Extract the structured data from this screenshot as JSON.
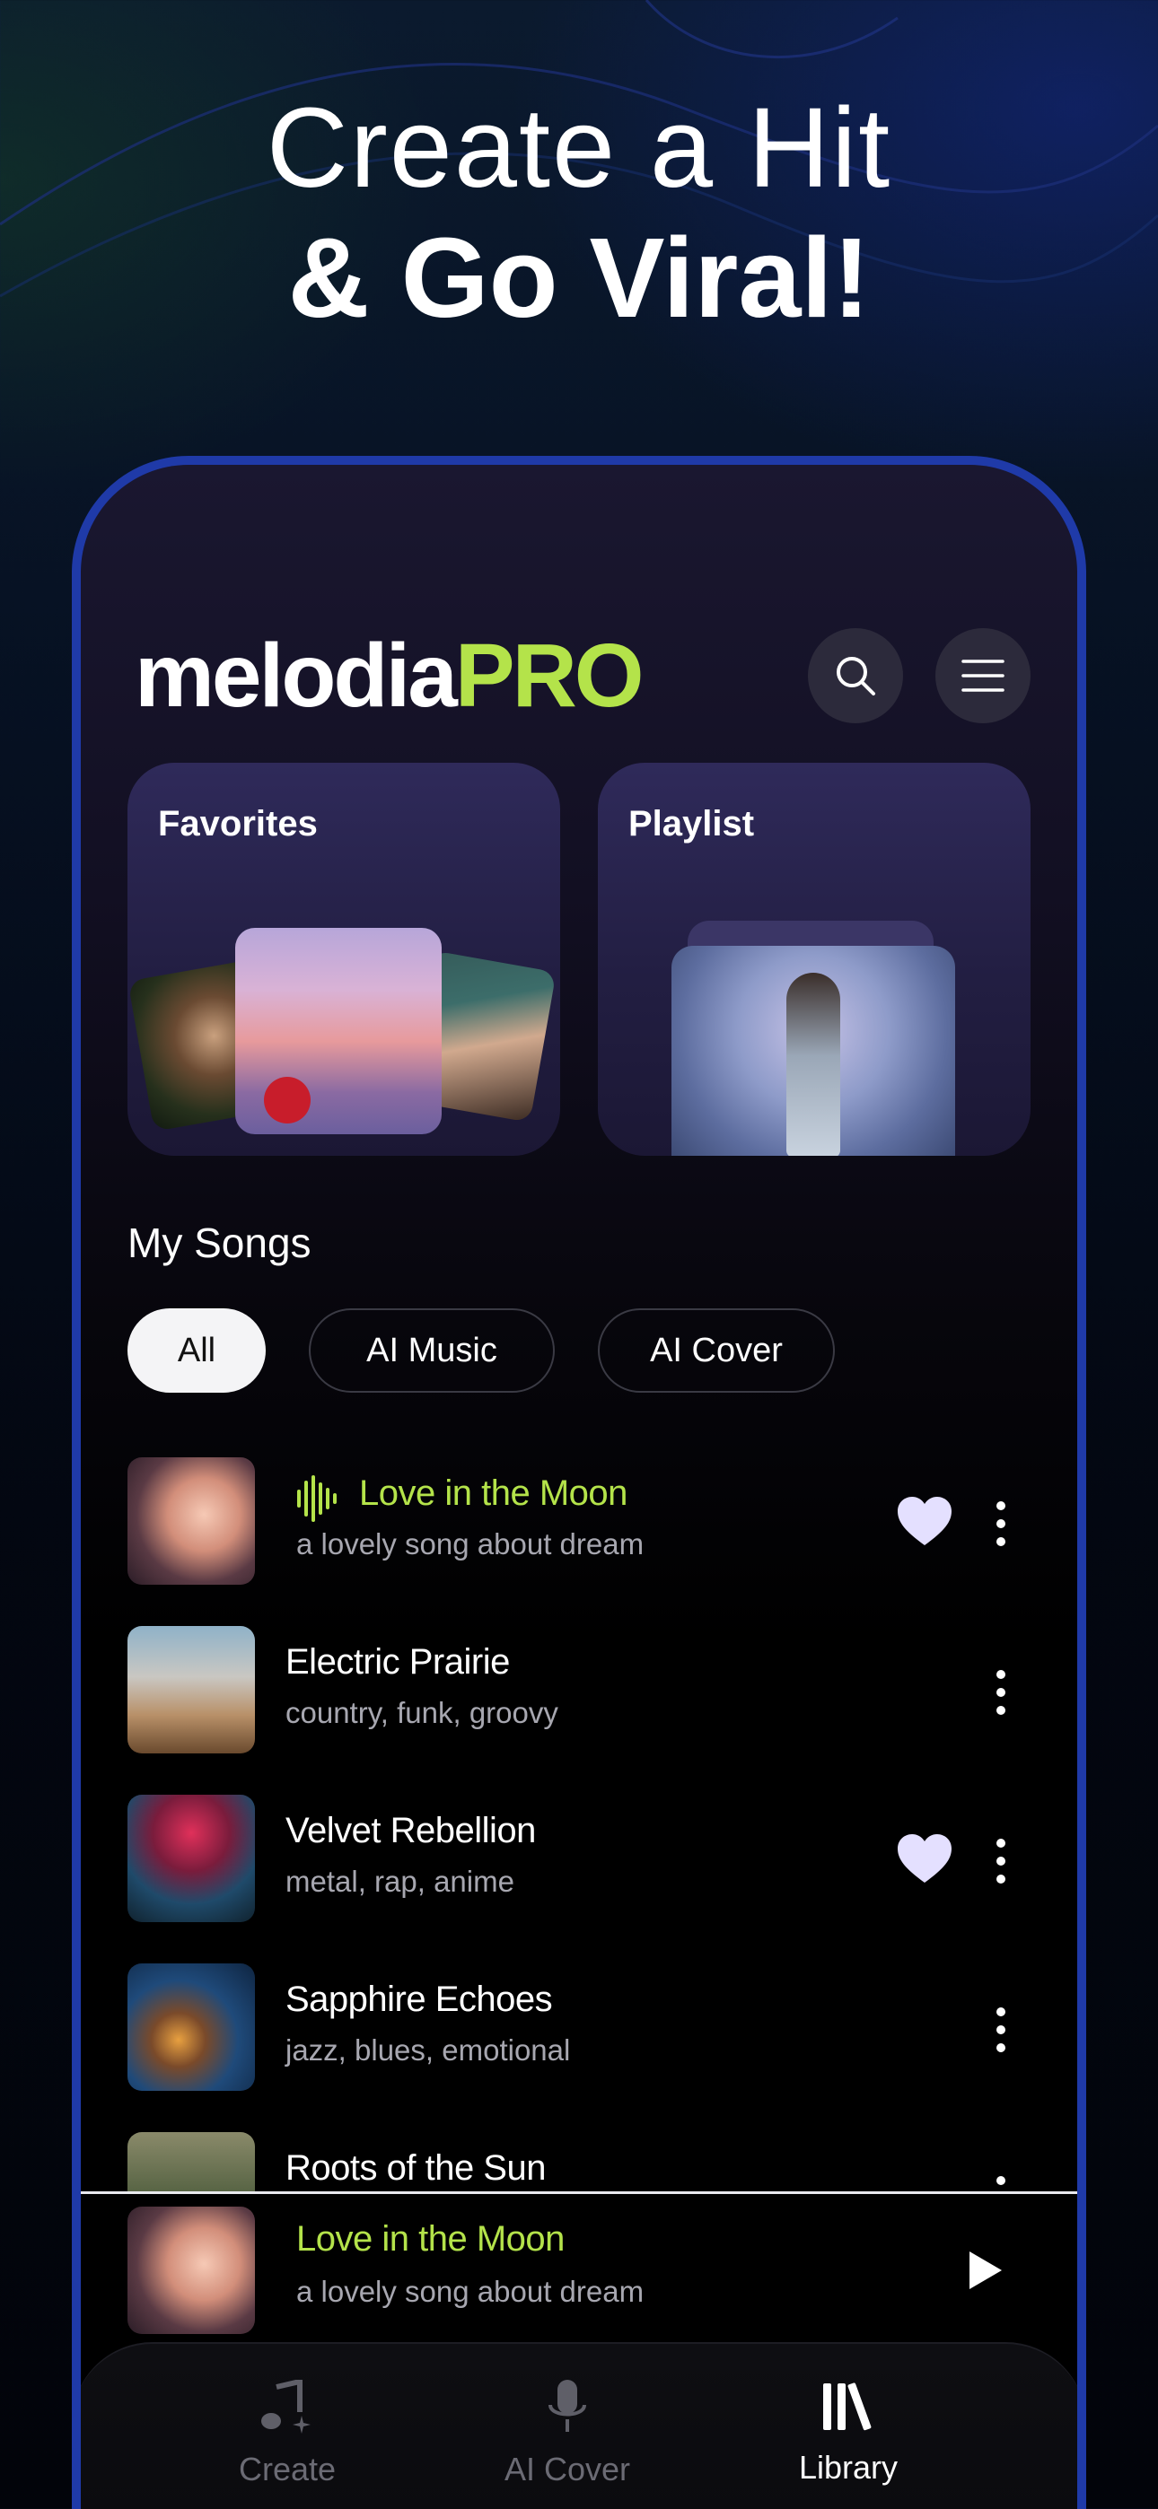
{
  "headline": {
    "line1": "Create a Hit",
    "line2": "& Go Viral!"
  },
  "app": {
    "logo_main": "melodia",
    "logo_accent": "PRO"
  },
  "header": {
    "search_icon": "search-icon",
    "menu_icon": "hamburger-menu-icon"
  },
  "cards": [
    {
      "title": "Favorites"
    },
    {
      "title": "Playlist"
    }
  ],
  "my_songs": {
    "title": "My Songs",
    "filters": [
      "All",
      "AI Music",
      "AI Cover"
    ],
    "active_filter": "All",
    "songs": [
      {
        "title": "Love in the Moon",
        "subtitle": "a lovely song about dream",
        "favorite": true,
        "playing": true
      },
      {
        "title": "Electric Prairie",
        "subtitle": "country, funk, groovy",
        "favorite": false,
        "playing": false
      },
      {
        "title": "Velvet Rebellion",
        "subtitle": "metal, rap, anime",
        "favorite": true,
        "playing": false
      },
      {
        "title": "Sapphire Echoes",
        "subtitle": "jazz, blues, emotional",
        "favorite": false,
        "playing": false
      },
      {
        "title": "Roots of the Sun",
        "subtitle": "",
        "favorite": false,
        "playing": false
      }
    ]
  },
  "now_playing": {
    "title": "Love in the Moon",
    "subtitle": "a lovely song about dream"
  },
  "tabs": [
    {
      "label": "Create",
      "icon": "music-note-sparkle-icon",
      "active": false
    },
    {
      "label": "AI Cover",
      "icon": "microphone-icon",
      "active": false
    },
    {
      "label": "Library",
      "icon": "library-icon",
      "active": true
    }
  ],
  "colors": {
    "accent": "#b4e34a",
    "frame": "#1f3aa8",
    "heart": "#e4e0ff"
  }
}
